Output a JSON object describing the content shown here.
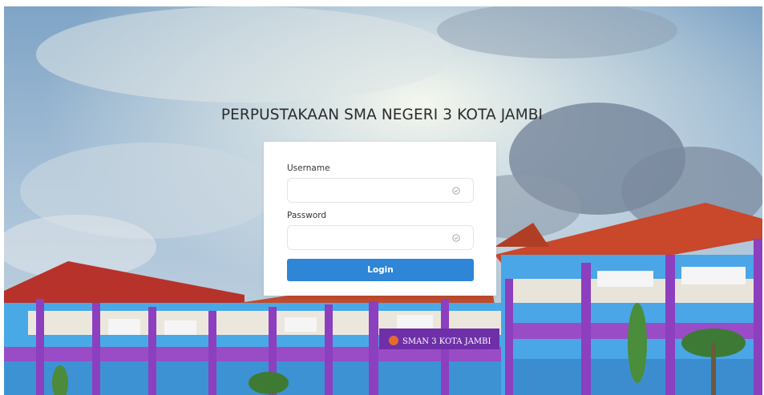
{
  "page": {
    "title": "PERPUSTAKAAN SMA NEGERI 3 KOTA JAMBI"
  },
  "background": {
    "building_sign": "SMAN 3 KOTA JAMBI"
  },
  "login_form": {
    "username_label": "Username",
    "username_value": "",
    "username_placeholder": "",
    "password_label": "Password",
    "password_value": "",
    "password_placeholder": "",
    "login_label": "Login",
    "accent_color": "#2f86d6",
    "field_icon": "check-circle-icon"
  }
}
